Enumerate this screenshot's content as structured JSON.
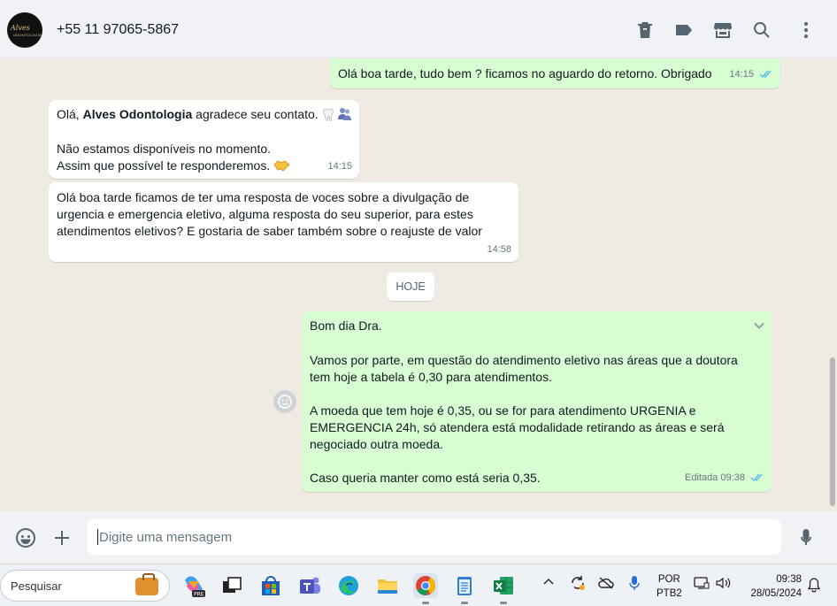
{
  "contact": {
    "name": "+55 11 97065-5867",
    "avatar_line1": "Alves",
    "avatar_line2": "ODONTOLOGIA"
  },
  "header_icons": [
    "trash-icon",
    "label-icon",
    "store-icon",
    "search-icon",
    "menu-icon"
  ],
  "messages": [
    {
      "dir": "out",
      "text": "Olá boa tarde, tudo bem ? ficamos no aguardo do retorno. Obrigado",
      "time": "14:15",
      "status": "read"
    },
    {
      "dir": "in",
      "greeting_prefix": "Olá, ",
      "greeting_bold": "Alves Odontologia",
      "greeting_suffix": " agradece seu contato.",
      "line2": "Não estamos disponíveis no momento.",
      "line3": "Assim que possível te responderemos.",
      "time": "14:15"
    },
    {
      "dir": "in",
      "line1": "Olá boa tarde ficamos de ter uma resposta de voces sobre a divulgação de",
      "line2": "urgencia e emergencia eletivo, alguma resposta do seu superior, para estes",
      "line3": "atendimentos eletivos? E gostaria de saber também sobre o reajuste de valor",
      "time": "14:58"
    },
    {
      "dir": "out",
      "p1": "Bom dia Dra.",
      "p2a": "Vamos por parte, em questão do atendimento eletivo nas áreas que a doutora",
      "p2b": "tem hoje a tabela é 0,30 para atendimentos.",
      "p3a": "A moeda que tem hoje é 0,35, ou se for para atendimento URGENIA e",
      "p3b": "EMERGENCIA 24h, só atendera está modalidade retirando as áreas e será",
      "p3c": "negociado outra moeda.",
      "p4": "Caso queria manter como está seria 0,35.",
      "edited": "Editada",
      "time": "09:38",
      "status": "read"
    }
  ],
  "date_chip": "HOJE",
  "compose": {
    "placeholder": "Digite uma mensagem"
  },
  "taskbar": {
    "search_label": "Pesquisar",
    "lang1": "POR",
    "lang2": "PTB2",
    "time": "09:38",
    "date": "28/05/2024"
  },
  "colors": {
    "outgoing": "#d9fdd3",
    "incoming": "#ffffff",
    "read_ticks": "#53bdeb",
    "chat_bg": "#efeae2"
  }
}
